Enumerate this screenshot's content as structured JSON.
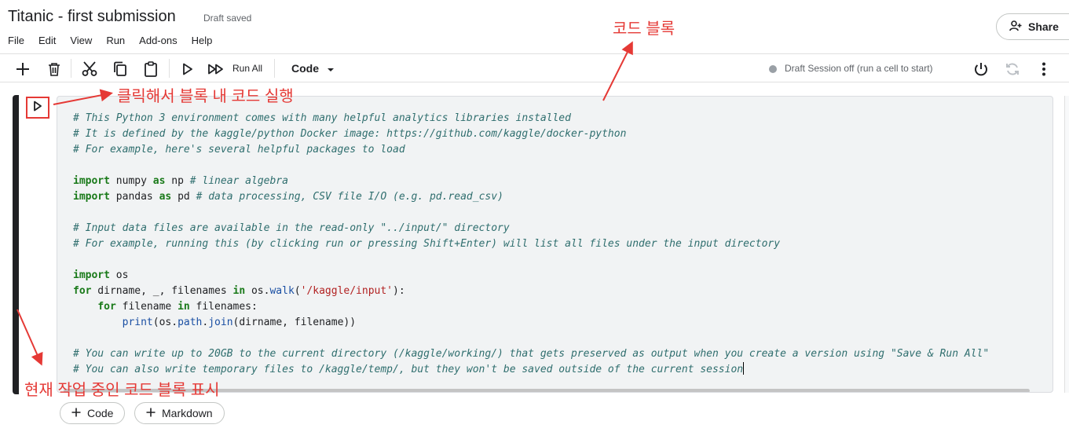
{
  "header": {
    "title": "Titanic - first submission",
    "draft_status": "Draft saved",
    "menu": [
      "File",
      "Edit",
      "View",
      "Run",
      "Add-ons",
      "Help"
    ],
    "share_label": "Share"
  },
  "toolbar": {
    "run_all_label": "Run All",
    "cell_type": "Code",
    "session_status": "Draft Session off (run a cell to start)"
  },
  "cell": {
    "code_lines": [
      "# This Python 3 environment comes with many helpful analytics libraries installed",
      "# It is defined by the kaggle/python Docker image: https://github.com/kaggle/docker-python",
      "# For example, here's several helpful packages to load",
      "",
      "import numpy as np # linear algebra",
      "import pandas as pd # data processing, CSV file I/O (e.g. pd.read_csv)",
      "",
      "# Input data files are available in the read-only \"../input/\" directory",
      "# For example, running this (by clicking run or pressing Shift+Enter) will list all files under the input directory",
      "",
      "import os",
      "for dirname, _, filenames in os.walk('/kaggle/input'):",
      "    for filename in filenames:",
      "        print(os.path.join(dirname, filename))",
      "",
      "# You can write up to 20GB to the current directory (/kaggle/working/) that gets preserved as output when you create a version using \"Save & Run All\"",
      "# You can also write temporary files to /kaggle/temp/, but they won't be saved outside of the current session"
    ]
  },
  "add_buttons": {
    "code_label": "Code",
    "markdown_label": "Markdown"
  },
  "annotations": {
    "code_block": "코드 블록",
    "run_hint": "클릭해서 블록 내 코드 실행",
    "active_indicator": "현재 작업 중인 코드 블록 표시"
  },
  "colors": {
    "annotation": "#e53935",
    "comment": "#2f6e6e",
    "keyword": "#1a7a1a",
    "string": "#b22222",
    "active_bar": "#202124"
  },
  "icons": [
    "add-icon",
    "trash-icon",
    "cut-icon",
    "copy-icon",
    "paste-icon",
    "play-icon",
    "fast-forward-icon",
    "chevron-down-icon",
    "power-icon",
    "refresh-icon",
    "more-vert-icon",
    "person-add-icon"
  ]
}
